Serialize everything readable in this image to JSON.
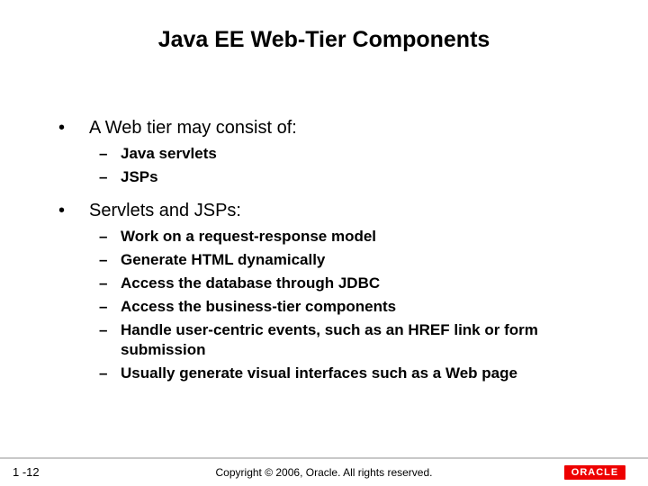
{
  "title": "Java EE Web-Tier Components",
  "bullets": [
    {
      "text": "A Web tier may consist of:",
      "sub": [
        "Java servlets",
        "JSPs"
      ]
    },
    {
      "text": "Servlets and JSPs:",
      "sub": [
        "Work on a request-response model",
        "Generate HTML dynamically",
        "Access the database through JDBC",
        "Access the business-tier components",
        "Handle user-centric events, such as an HREF link or form submission",
        "Usually generate visual interfaces such as a Web page"
      ]
    }
  ],
  "footer": {
    "page": "1 -12",
    "copyright": "Copyright © 2006, Oracle.  All rights reserved.",
    "logo_text": "ORACLE"
  }
}
